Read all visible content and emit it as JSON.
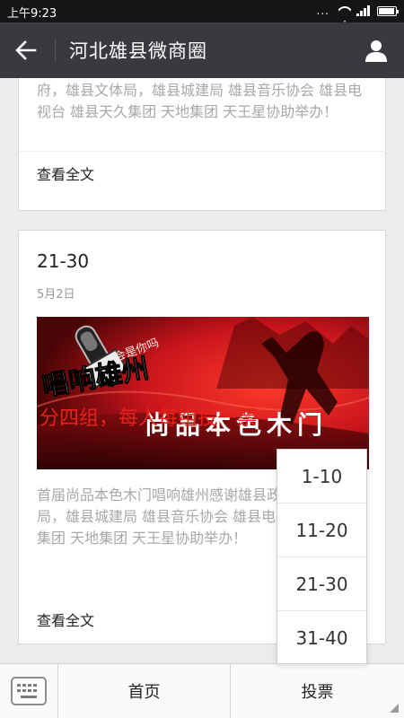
{
  "status_bar": {
    "time": "上午9:23",
    "dots": "...",
    "icons": [
      "wifi-icon",
      "signal-icon",
      "battery-icon"
    ]
  },
  "header": {
    "title": "河北雄县微商圈",
    "back_icon": "arrow-left-icon",
    "profile_icon": "person-icon"
  },
  "cards": [
    {
      "excerpt": "府，雄县文体局，雄县城建局 雄县音乐协会 雄县电视台 雄县天久集团 天地集团 天王星协助举办！",
      "read_more": "查看全文"
    },
    {
      "title": "21-30",
      "date": "5月2日",
      "cover": {
        "logo_text": "唱响雄州",
        "banner_text": "尚品本色木门",
        "small_text": "会是你吗"
      },
      "excerpt": "首届尚品本色木门唱响雄州感谢雄县政府，雄县文体局，雄县城建局 雄县音乐协会 雄县电视台 雄县天久集团 天地集团 天王星协助举办！",
      "overlay": "分四组，每人每组投一票",
      "read_more": "查看全文"
    }
  ],
  "vote_menu": {
    "items": [
      "1-10",
      "11-20",
      "21-30",
      "31-40"
    ]
  },
  "bottom_menu": {
    "keyboard_icon": "keyboard-icon",
    "home": "首页",
    "vote": "投票"
  },
  "colors": {
    "nav_bg": "#393a3f",
    "status_bg": "#151515",
    "overlay_text": "#e8221a",
    "cover_red": "#c8141c"
  }
}
